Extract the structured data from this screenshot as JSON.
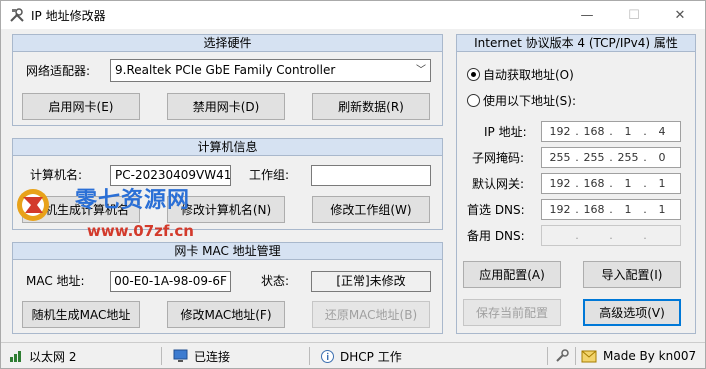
{
  "window": {
    "title": "IP 地址修改器",
    "min_icon": "minimize-icon",
    "max_icon": "maximize-icon",
    "close_icon": "close-icon"
  },
  "hardware": {
    "header": "选择硬件",
    "adapter_label": "网络适配器:",
    "adapter_value": "9.Realtek PCIe GbE Family Controller",
    "enable_btn": "启用网卡(E)",
    "disable_btn": "禁用网卡(D)",
    "refresh_btn": "刷新数据(R)"
  },
  "computer": {
    "header": "计算机信息",
    "name_label": "计算机名:",
    "name_value": "PC-20230409VW41",
    "workgroup_label": "工作组:",
    "workgroup_value": "",
    "random_btn": "随机生成计算机名",
    "rename_btn": "修改计算机名(N)",
    "workgroup_btn": "修改工作组(W)"
  },
  "mac": {
    "header": "网卡 MAC 地址管理",
    "mac_label": "MAC 地址:",
    "mac_value": "00-E0-1A-98-09-6F",
    "state_label": "状态:",
    "state_value": "[正常]未修改",
    "random_btn": "随机生成MAC地址",
    "modify_btn": "修改MAC地址(F)",
    "restore_btn": "还原MAC地址(B)"
  },
  "ipv4": {
    "header": "Internet 协议版本 4 (TCP/IPv4) 属性",
    "auto_radio": "自动获取地址(O)",
    "manual_radio": "使用以下地址(S):",
    "ip_label": "IP 地址:",
    "ip": [
      "192",
      "168",
      "1",
      "4"
    ],
    "mask_label": "子网掩码:",
    "mask": [
      "255",
      "255",
      "255",
      "0"
    ],
    "gateway_label": "默认网关:",
    "gateway": [
      "192",
      "168",
      "1",
      "1"
    ],
    "dns1_label": "首选 DNS:",
    "dns1": [
      "192",
      "168",
      "1",
      "1"
    ],
    "dns2_label": "备用 DNS:",
    "dns2": [
      "",
      "",
      "",
      ""
    ],
    "apply_btn": "应用配置(A)",
    "import_btn": "导入配置(I)",
    "save_btn": "保存当前配置",
    "advanced_btn": "高级选项(V)"
  },
  "statusbar": {
    "network": "以太网 2",
    "connection": "已连接",
    "dhcp": "DHCP 工作",
    "author": "Made By kn007"
  },
  "watermark": {
    "text1": "零七资源网",
    "text2": "www.07zf.cn"
  }
}
